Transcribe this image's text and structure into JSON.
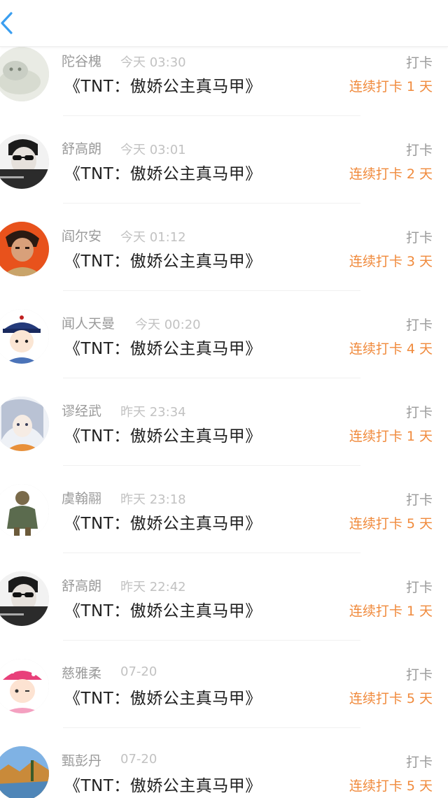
{
  "header": {
    "back_icon": "chevron-left-icon",
    "accent_color": "#3a9ef0"
  },
  "feed": {
    "items": [
      {
        "user": "陀谷槐",
        "time": "今天 03:30",
        "book": "《TNT：傲娇公主真马甲》",
        "action": "打卡",
        "streak": "连续打卡 1 天",
        "avatar": "cat-avatar"
      },
      {
        "user": "舒高朗",
        "time": "今天 03:01",
        "book": "《TNT：傲娇公主真马甲》",
        "action": "打卡",
        "streak": "连续打卡 2 天",
        "avatar": "sunglasses-avatar"
      },
      {
        "user": "阎尔安",
        "time": "今天 01:12",
        "book": "《TNT：傲娇公主真马甲》",
        "action": "打卡",
        "streak": "连续打卡 3 天",
        "avatar": "anime-orange-avatar"
      },
      {
        "user": "闻人天曼",
        "time": "今天 00:20",
        "book": "《TNT：傲娇公主真马甲》",
        "action": "打卡",
        "streak": "连续打卡 4 天",
        "avatar": "qing-hat-avatar"
      },
      {
        "user": "谬经武",
        "time": "昨天 23:34",
        "book": "《TNT：傲娇公主真马甲》",
        "action": "打卡",
        "streak": "连续打卡 1 天",
        "avatar": "silver-hair-avatar"
      },
      {
        "user": "虞翰翮",
        "time": "昨天 23:18",
        "book": "《TNT：傲娇公主真马甲》",
        "action": "打卡",
        "streak": "连续打卡 5 天",
        "avatar": "statue-avatar"
      },
      {
        "user": "舒高朗",
        "time": "昨天 22:42",
        "book": "《TNT：傲娇公主真马甲》",
        "action": "打卡",
        "streak": "连续打卡 1 天",
        "avatar": "sunglasses-avatar"
      },
      {
        "user": "慈雅柔",
        "time": "07-20",
        "book": "《TNT：傲娇公主真马甲》",
        "action": "打卡",
        "streak": "连续打卡 5 天",
        "avatar": "pink-cap-avatar"
      },
      {
        "user": "甄彭丹",
        "time": "07-20",
        "book": "《TNT：傲娇公主真马甲》",
        "action": "打卡",
        "streak": "连续打卡 5 天",
        "avatar": "landscape-avatar"
      }
    ]
  }
}
